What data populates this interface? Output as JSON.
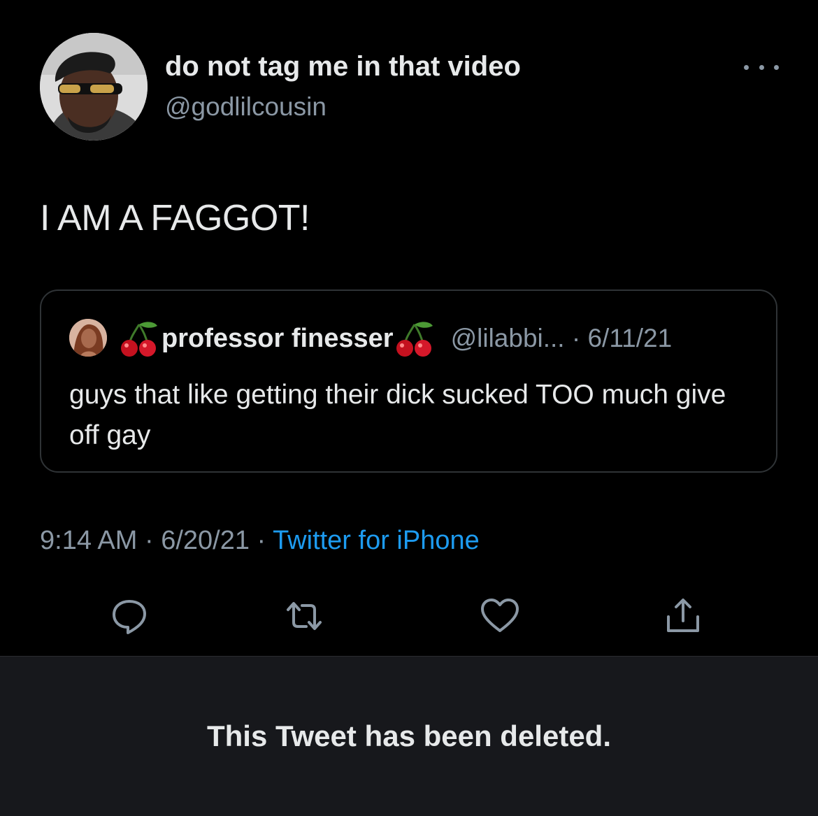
{
  "tweet": {
    "display_name": "do not tag me in that video",
    "handle": "@godlilcousin",
    "text": "I AM A FAGGOT!",
    "timestamp": "9:14 AM · 6/20/21 · ",
    "source": "Twitter for iPhone",
    "more_icon": "more-horizontal-icon"
  },
  "quoted_tweet": {
    "name": "professor finesser",
    "name_emoji": "cherries",
    "meta": "@lilabbi... · 6/11/21",
    "text": "guys that like getting their dick sucked TOO much give off gay"
  },
  "actions": [
    {
      "name": "reply",
      "icon": "reply-icon"
    },
    {
      "name": "retweet",
      "icon": "retweet-icon"
    },
    {
      "name": "like",
      "icon": "heart-icon"
    },
    {
      "name": "share",
      "icon": "share-icon"
    }
  ],
  "notice": {
    "text": "This Tweet has been deleted."
  },
  "colors": {
    "background": "#000000",
    "text": "#e7e9ea",
    "secondary_text": "#8b98a5",
    "link": "#1d9bf0",
    "deleted_bar": "#17181c"
  }
}
